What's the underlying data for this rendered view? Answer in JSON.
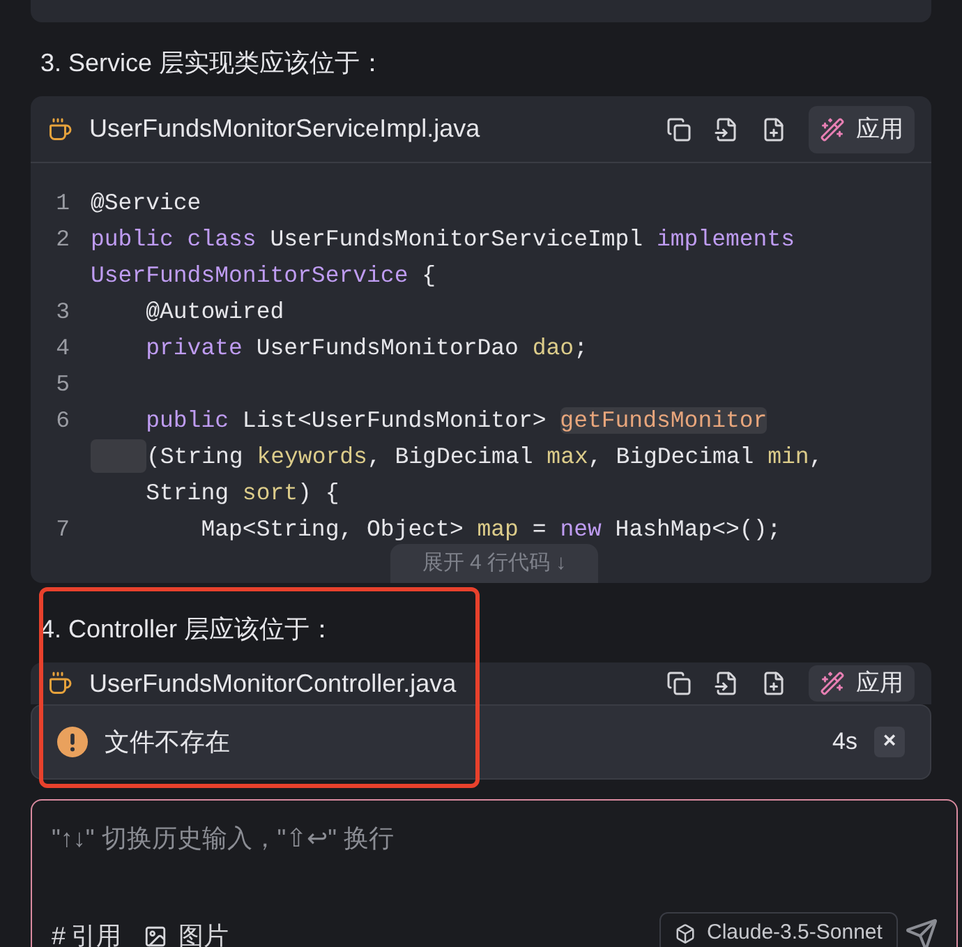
{
  "sections": [
    {
      "heading": "3. Service 层实现类应该位于：",
      "code_block": {
        "filename": "UserFundsMonitorServiceImpl.java",
        "apply_label": "应用",
        "expand_label": "展开 4 行代码 ↓",
        "rows": [
          {
            "number": "1",
            "tokens": [
              {
                "kind": "plain",
                "text": "@Service"
              }
            ]
          },
          {
            "number": "2",
            "tokens": [
              {
                "kind": "keyword",
                "text": "public class "
              },
              {
                "kind": "plain",
                "text": "UserFundsMonitorServiceImpl "
              },
              {
                "kind": "keyword",
                "text": "implements"
              }
            ]
          },
          {
            "tokens": [
              {
                "kind": "keyword",
                "text": "UserFundsMonitorService"
              },
              {
                "kind": "plain",
                "text": " {"
              }
            ]
          },
          {
            "number": "3",
            "tokens": [
              {
                "kind": "plain",
                "text": "    @Autowired"
              }
            ]
          },
          {
            "number": "4",
            "tokens": [
              {
                "kind": "keyword",
                "text": "    private "
              },
              {
                "kind": "plain",
                "text": "UserFundsMonitorDao "
              },
              {
                "kind": "variable",
                "text": "dao"
              },
              {
                "kind": "plain",
                "text": ";"
              }
            ]
          },
          {
            "number": "5",
            "tokens": []
          },
          {
            "number": "6",
            "tokens": [
              {
                "kind": "keyword",
                "text": "    public "
              },
              {
                "kind": "plain",
                "text": "List<UserFundsMonitor> "
              },
              {
                "kind": "function",
                "text": "getFundsMonitor"
              }
            ]
          },
          {
            "indent_marker": true,
            "tokens": [
              {
                "kind": "plain",
                "text": "(String "
              },
              {
                "kind": "variable",
                "text": "keywords"
              },
              {
                "kind": "plain",
                "text": ", BigDecimal "
              },
              {
                "kind": "variable",
                "text": "max"
              },
              {
                "kind": "plain",
                "text": ", BigDecimal "
              },
              {
                "kind": "variable",
                "text": "min"
              },
              {
                "kind": "plain",
                "text": ","
              }
            ]
          },
          {
            "tokens": [
              {
                "kind": "plain",
                "text": "    String "
              },
              {
                "kind": "variable",
                "text": "sort"
              },
              {
                "kind": "plain",
                "text": ") {"
              }
            ]
          },
          {
            "number": "7",
            "tokens": [
              {
                "kind": "plain",
                "text": "        Map<String, Object> "
              },
              {
                "kind": "variable",
                "text": "map"
              },
              {
                "kind": "plain",
                "text": " = "
              },
              {
                "kind": "keyword",
                "text": "new "
              },
              {
                "kind": "plain",
                "text": "HashMap<>();"
              }
            ]
          }
        ]
      }
    },
    {
      "heading": "4. Controller 层应该位于：",
      "code_block": {
        "filename": "UserFundsMonitorController.java",
        "apply_label": "应用",
        "compact": true
      }
    }
  ],
  "toast": {
    "message": "文件不存在",
    "countdown": "4s",
    "close": "×"
  },
  "composer": {
    "placeholder": "\"↑↓\" 切换历史输入，\"⇧↩\" 换行",
    "reference_label": "#",
    "reference_text": "引用",
    "image_text": "图片",
    "model": "Claude-3.5-Sonnet"
  }
}
